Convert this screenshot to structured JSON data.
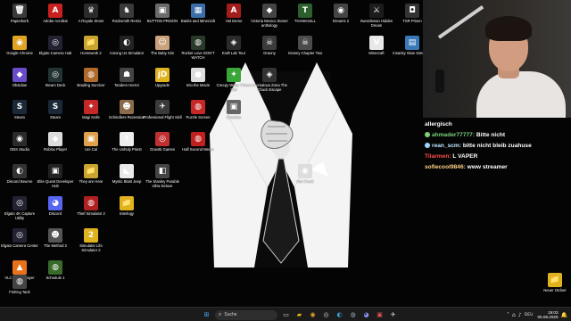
{
  "desktop": {
    "icons": [
      {
        "label": "Papierkorb",
        "glyph": "🗑",
        "color": "#3a3a3a"
      },
      {
        "label": "Adobe Acrobat",
        "glyph": "A",
        "color": "#c8201e"
      },
      {
        "label": "A Royale Stone",
        "glyph": "♛",
        "color": "#2b2b2b"
      },
      {
        "label": "Rocksmith Remix",
        "glyph": "♞",
        "color": "#3a3a3a"
      },
      {
        "label": "BUTTON PRISON",
        "glyph": "▣",
        "color": "#6b6b6b"
      },
      {
        "label": "Banks and Minecraft",
        "glyph": "▦",
        "color": "#3b6ea8"
      },
      {
        "label": "AM Demo",
        "glyph": "A",
        "color": "#a51c1c"
      },
      {
        "label": "Victoria Mexico Stoner anthology",
        "glyph": "◆",
        "color": "#444"
      },
      {
        "label": "THANKS4LL",
        "glyph": "T",
        "color": "#2c5f2d"
      },
      {
        "label": "Dreams 2",
        "glyph": "◉",
        "color": "#444"
      },
      {
        "label": "Swordsman Hidden Dream",
        "glyph": "⚔",
        "color": "#1c1c1c"
      },
      {
        "label": "TSR Prison",
        "glyph": "◘",
        "color": "#333"
      },
      {
        "label": "Google Chrome",
        "glyph": "◉",
        "color": "#e0a323"
      },
      {
        "label": "Elgato Camera Hub",
        "glyph": "◎",
        "color": "#223"
      },
      {
        "label": "Homework 2",
        "glyph": "📁",
        "color": "#c9a430"
      },
      {
        "label": "Among Us Simulator",
        "glyph": "◐",
        "color": "#222"
      },
      {
        "label": "The Baby Sim",
        "glyph": "☺",
        "color": "#c8a27c"
      },
      {
        "label": "Rocket Love DON'T WATCH",
        "glyph": "◍",
        "color": "#2a3a2a"
      },
      {
        "label": "Kraft Lab Tour",
        "glyph": "◈",
        "color": "#2b2b2b"
      },
      {
        "label": "Granny",
        "glyph": "☠",
        "color": "#3b3b3b"
      },
      {
        "label": "Granny Chapter Two",
        "glyph": "☠",
        "color": "#4b4b4b"
      },
      {
        "label": "Minecraft",
        "glyph": "V",
        "color": "#e8e8e8"
      },
      {
        "label": "Insanity Slow Simulator",
        "glyph": "▤",
        "color": "#3a79b8"
      },
      {
        "label": "Obsidian",
        "glyph": "◆",
        "color": "#6a4cc8"
      },
      {
        "label": "Steam Deck",
        "glyph": "◎",
        "color": "#233"
      },
      {
        "label": "Bowling Survivor",
        "glyph": "◍",
        "color": "#b06a2a"
      },
      {
        "label": "Tandem Horror",
        "glyph": "☗",
        "color": "#444"
      },
      {
        "label": "Upgrade",
        "glyph": "jD",
        "color": "#e0b21e"
      },
      {
        "label": "Into the Movie",
        "glyph": "●",
        "color": "#ddd"
      },
      {
        "label": "Creepy Water Prison Sim",
        "glyph": "✦",
        "color": "#3aa63a"
      },
      {
        "label": "Anomalous Zona The Chuck Escape",
        "glyph": "◈",
        "color": "#333"
      },
      {
        "label": "Steam",
        "glyph": "S",
        "color": "#1b2838"
      },
      {
        "label": "Steam",
        "glyph": "S",
        "color": "#1b2838"
      },
      {
        "label": "Magi Knife",
        "glyph": "✦",
        "color": "#c62828"
      },
      {
        "label": "Schindlers Rezession",
        "glyph": "☻",
        "color": "#8a6a4a"
      },
      {
        "label": "Professional Flight Skill",
        "glyph": "✈",
        "color": "#3a3a3a"
      },
      {
        "label": "Puzzle Screen",
        "glyph": "◍",
        "color": "#c62828"
      },
      {
        "label": "Obsolete",
        "glyph": "▣",
        "color": "#666"
      },
      {
        "label": "OBS Studio",
        "glyph": "◉",
        "color": "#2a2a2a"
      },
      {
        "label": "Roblox Player",
        "glyph": "◆",
        "color": "#ddd"
      },
      {
        "label": "Uni Cal",
        "glyph": "▣",
        "color": "#e0a04c"
      },
      {
        "label": "The Unholy Priest",
        "glyph": "✝",
        "color": "#eee"
      },
      {
        "label": "Gravitti Games",
        "glyph": "◎",
        "color": "#c03030"
      },
      {
        "label": "Half Second Meme",
        "glyph": "◍",
        "color": "#c02020"
      },
      {
        "label": "Discord Beurne",
        "glyph": "◐",
        "color": "#333"
      },
      {
        "label": "Elite Quest Developer Hub",
        "glyph": "▣",
        "color": "#222"
      },
      {
        "label": "They are Here",
        "glyph": "📁",
        "color": "#c9a430"
      },
      {
        "label": "Mystic Blast Jeep",
        "glyph": "◣",
        "color": "#e8e8e8"
      },
      {
        "label": "The Stanley Parable Ultra Deluxe",
        "glyph": "◧",
        "color": "#444"
      },
      {
        "label": "Elgato 4K Capture Utility",
        "glyph": "◎",
        "color": "#223"
      },
      {
        "label": "Discord",
        "glyph": "◕",
        "color": "#5865f2"
      },
      {
        "label": "Thief Simulator 2",
        "glyph": "◍",
        "color": "#b02020"
      },
      {
        "label": "Interlogy",
        "glyph": "📁",
        "color": "#e0b21e"
      },
      {
        "label": "Elgato Camera Center",
        "glyph": "◎",
        "color": "#223"
      },
      {
        "label": "The Method 2",
        "glyph": "☻",
        "color": "#555"
      },
      {
        "label": "Simulator Life Simulator 2",
        "glyph": "2",
        "color": "#e0b21e"
      },
      {
        "label": "VLC media player",
        "glyph": "▲",
        "color": "#e8721c"
      },
      {
        "label": "Schedule 1",
        "glyph": "◍",
        "color": "#3a6a2a"
      },
      {
        "label": "Fishing Tank",
        "glyph": "◍",
        "color": "#444"
      },
      {
        "label": "Hat Check",
        "glyph": "◉",
        "color": "#ddd"
      },
      {
        "label": "Neuer Ordner",
        "glyph": "📁",
        "color": "#e0b21e"
      }
    ]
  },
  "webcam": {
    "alt": ""
  },
  "chat": {
    "header_user": "allergisch",
    "messages": [
      {
        "user": "ahmader77777:",
        "text": "Bitte nicht",
        "user_color": "#7ad17a",
        "badge": "#7ad17a"
      },
      {
        "user": "rean_scm:",
        "text": "bitte nicht bleib zuahuse",
        "user_color": "#bfe8ff",
        "badge": "#9ad6ff"
      },
      {
        "user": "Tilarmen:",
        "text": "L VAPER",
        "user_color": "#ff4d4d",
        "badge": ""
      },
      {
        "user": "sofiecool9846:",
        "text": "www streamer",
        "user_color": "#ffd38a",
        "badge": ""
      }
    ]
  },
  "taskbar": {
    "search_placeholder": "Suche",
    "time": "19:03",
    "date": "05.06.2025",
    "lang": "DEU"
  }
}
